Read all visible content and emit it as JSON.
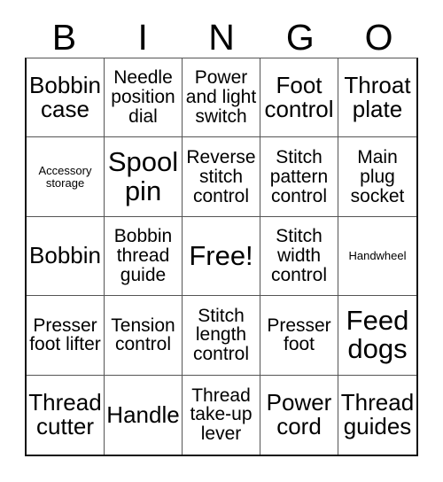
{
  "card": {
    "type": "bingo-card",
    "title_letters": [
      "B",
      "I",
      "N",
      "G",
      "O"
    ],
    "columns": 5,
    "rows": 5,
    "free_space_label": "Free!",
    "free_space_position": {
      "row": 3,
      "column": 3
    },
    "border_color": "#111111",
    "grid_line_color": "#555555",
    "text_color": "#000000",
    "background_color": "#ffffff",
    "cells": [
      [
        {
          "label": "Bobbin case",
          "size": "lg"
        },
        {
          "label": "Needle position dial",
          "size": "md"
        },
        {
          "label": "Power and light switch",
          "size": "md"
        },
        {
          "label": "Foot control",
          "size": "lg"
        },
        {
          "label": "Throat plate",
          "size": "lg"
        }
      ],
      [
        {
          "label": "Accessory storage",
          "size": "xs"
        },
        {
          "label": "Spool pin",
          "size": "xl"
        },
        {
          "label": "Reverse stitch control",
          "size": "md"
        },
        {
          "label": "Stitch pattern control",
          "size": "md"
        },
        {
          "label": "Main plug socket",
          "size": "md"
        }
      ],
      [
        {
          "label": "Bobbin",
          "size": "lg"
        },
        {
          "label": "Bobbin thread guide",
          "size": "md"
        },
        {
          "label": "Free!",
          "size": "xl"
        },
        {
          "label": "Stitch width control",
          "size": "md"
        },
        {
          "label": "Handwheel",
          "size": "xs"
        }
      ],
      [
        {
          "label": "Presser foot lifter",
          "size": "md"
        },
        {
          "label": "Tension control",
          "size": "md"
        },
        {
          "label": "Stitch length control",
          "size": "md"
        },
        {
          "label": "Presser foot",
          "size": "md"
        },
        {
          "label": "Feed dogs",
          "size": "xl"
        }
      ],
      [
        {
          "label": "Thread cutter",
          "size": "lg"
        },
        {
          "label": "Handle",
          "size": "lg"
        },
        {
          "label": "Thread take-up lever",
          "size": "md"
        },
        {
          "label": "Power cord",
          "size": "lg"
        },
        {
          "label": "Thread guides",
          "size": "lg"
        }
      ]
    ]
  }
}
